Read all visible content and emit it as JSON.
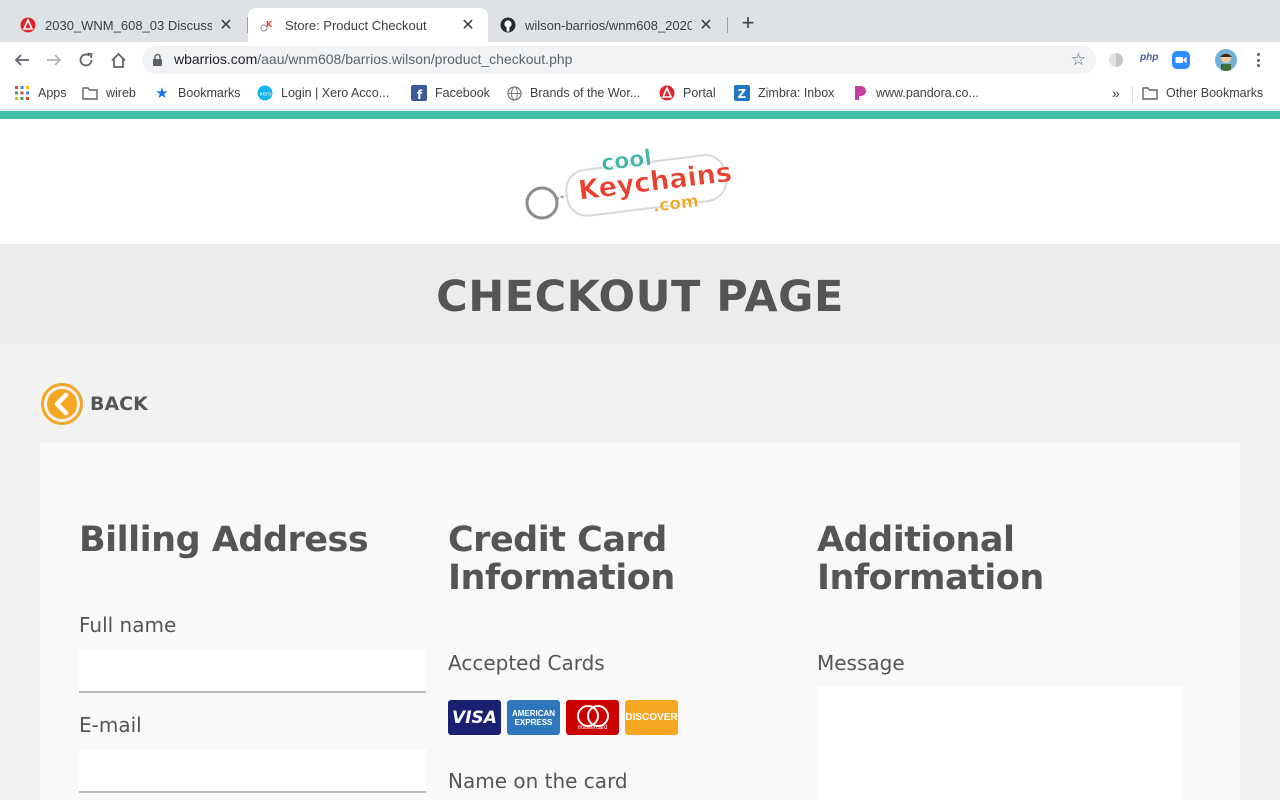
{
  "browser": {
    "tabs": [
      {
        "title": "2030_WNM_608_03 Discussio",
        "favicon": "aau-icon"
      },
      {
        "title": "Store: Product Checkout",
        "favicon": "keychain-icon",
        "active": true
      },
      {
        "title": "wilson-barrios/wnm608_2020:",
        "favicon": "github-icon"
      }
    ],
    "url_host": "wbarrios.com",
    "url_path": "/aau/wnm608/barrios.wilson/product_checkout.php",
    "bookmarks": [
      {
        "label": "Apps",
        "icon": "apps-grid-icon"
      },
      {
        "label": "wireb",
        "icon": "folder-icon"
      },
      {
        "label": "Bookmarks",
        "icon": "star-icon"
      },
      {
        "label": "Login | Xero Acco...",
        "icon": "xero-icon"
      },
      {
        "label": "Facebook",
        "icon": "facebook-icon"
      },
      {
        "label": "Brands of the Wor...",
        "icon": "globe-icon"
      },
      {
        "label": "Portal",
        "icon": "aau-icon"
      },
      {
        "label": "Zimbra: Inbox",
        "icon": "zimbra-icon"
      },
      {
        "label": "www.pandora.co...",
        "icon": "pandora-icon"
      }
    ],
    "overflow": "»",
    "other_bookmarks": "Other Bookmarks",
    "ext_php": "php"
  },
  "site": {
    "logo": {
      "line1": "cool",
      "line2": "Keychains",
      "line3": ".com"
    },
    "page_title": "CHECKOUT PAGE",
    "back_label": "BACK"
  },
  "billing": {
    "heading": "Billing Address",
    "fullname_label": "Full name",
    "email_label": "E-mail"
  },
  "credit": {
    "heading_line1": "Credit Card",
    "heading_line2": "Information",
    "accepted_label": "Accepted Cards",
    "cards": [
      "VISA",
      "AMERICAN EXPRESS",
      "mastercard",
      "DISCOVER"
    ],
    "name_label": "Name on the card"
  },
  "additional": {
    "heading_line1": "Additional",
    "heading_line2": "Information",
    "message_label": "Message"
  },
  "colors": {
    "teal": "#42bfa6",
    "orange": "#f5a623",
    "heading": "#555555"
  }
}
